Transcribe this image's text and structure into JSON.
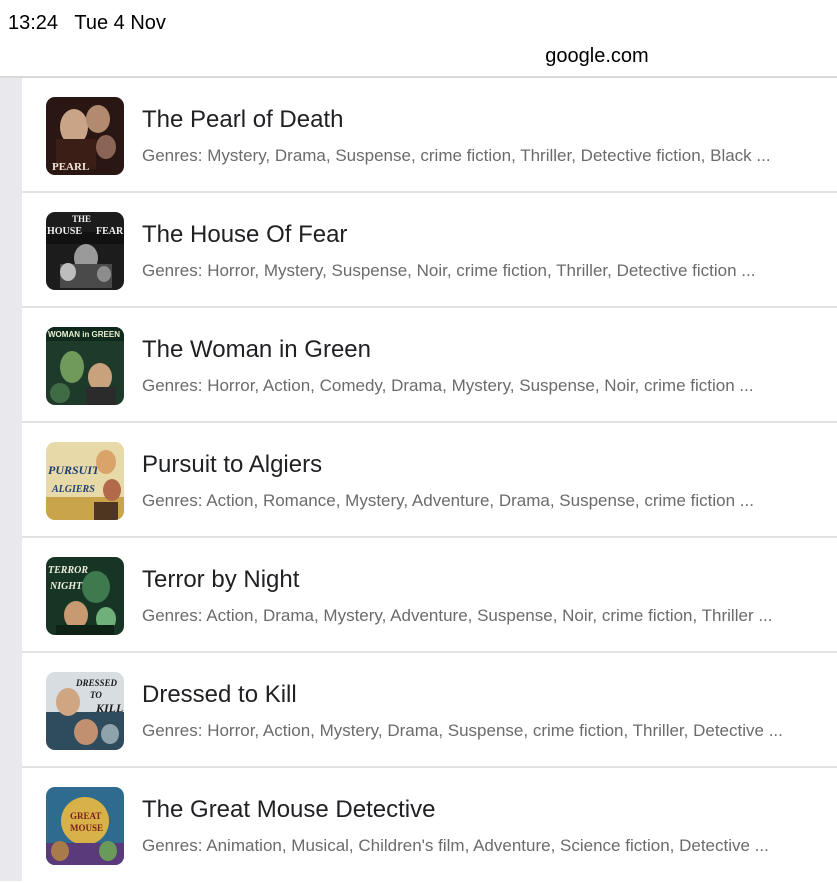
{
  "status_bar": {
    "time": "13:24",
    "date": "Tue 4 Nov"
  },
  "url_bar": {
    "domain": "google.com"
  },
  "results": [
    {
      "title": "The Pearl of Death",
      "genres": "Genres: Mystery, Drama, Suspense, crime fiction, Thriller, Detective fiction, Black ...",
      "poster_text": "PEARL"
    },
    {
      "title": "The House Of Fear",
      "genres": "Genres: Horror, Mystery, Suspense, Noir, crime fiction, Thriller, Detective fiction ...",
      "poster_text": "HOUSE FEAR"
    },
    {
      "title": "The Woman in Green",
      "genres": "Genres: Horror, Action, Comedy, Drama, Mystery, Suspense, Noir, crime fiction ...",
      "poster_text": "WOMAN IN GREEN"
    },
    {
      "title": "Pursuit to Algiers",
      "genres": "Genres: Action, Romance, Mystery, Adventure, Drama, Suspense, crime fiction ...",
      "poster_text": "PURSUIT ALGIERS"
    },
    {
      "title": "Terror by Night",
      "genres": "Genres: Action, Drama, Mystery, Adventure, Suspense, Noir, crime fiction, Thriller ...",
      "poster_text": "TERROR NIGHT"
    },
    {
      "title": "Dressed to Kill",
      "genres": "Genres: Horror, Action, Mystery, Drama, Suspense, crime fiction, Thriller, Detective ...",
      "poster_text": "DRESSED TO KILL"
    },
    {
      "title": "The Great Mouse Detective",
      "genres": "Genres: Animation, Musical, Children's film, Adventure, Science fiction, Detective ...",
      "poster_text": "GREAT MOUSE"
    }
  ],
  "colors": {
    "title_text": "#202124",
    "secondary_text": "#6b6b6b",
    "divider": "#e2e2e2",
    "gutter": "#e8e8ed"
  }
}
